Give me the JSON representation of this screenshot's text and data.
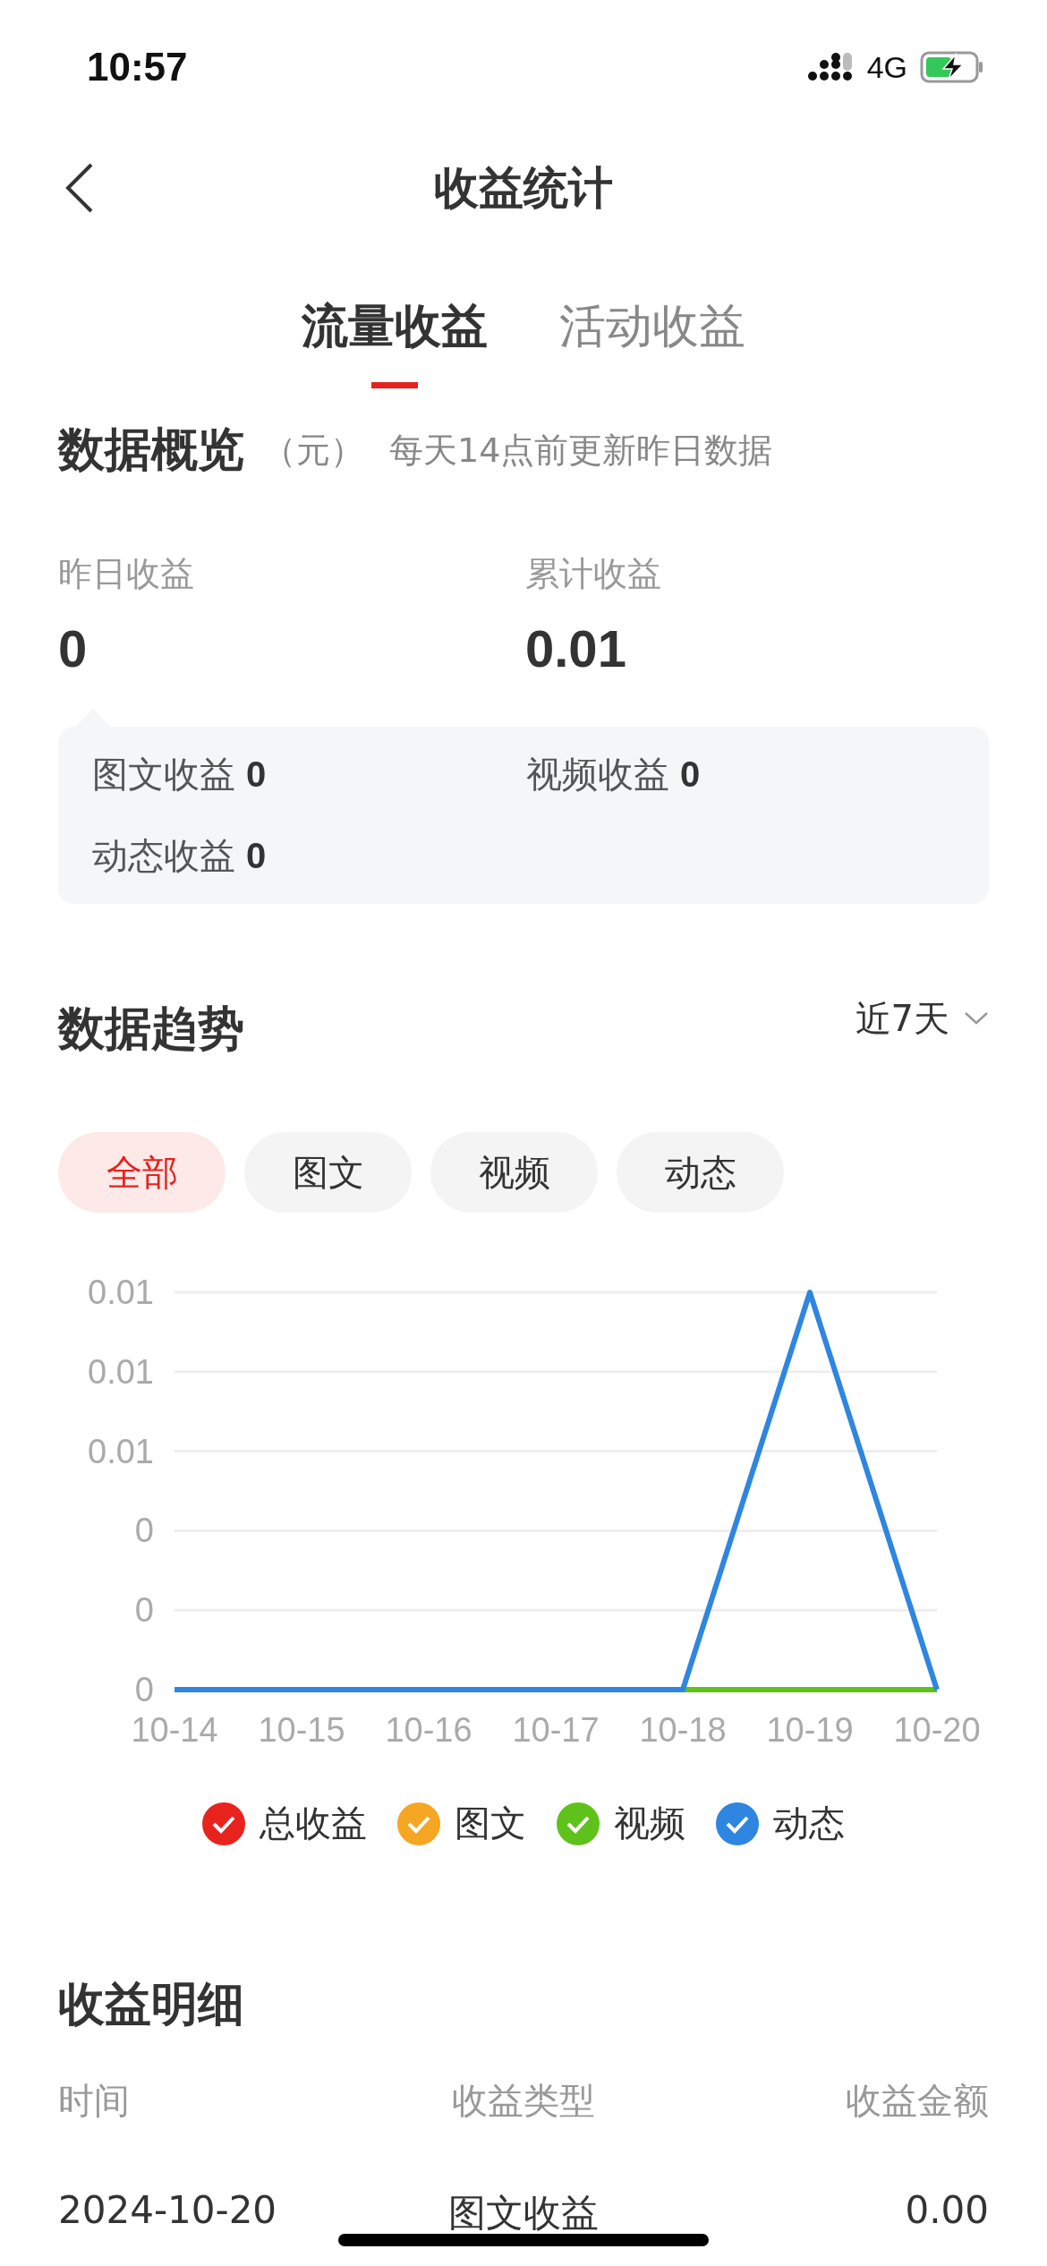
{
  "status_bar": {
    "time": "10:57",
    "network": "4G"
  },
  "header": {
    "title": "收益统计"
  },
  "tabs": [
    {
      "label": "流量收益",
      "selected": true
    },
    {
      "label": "活动收益",
      "selected": false
    }
  ],
  "overview": {
    "title": "数据概览",
    "unit": "（元）",
    "note": "每天14点前更新昨日数据",
    "stats": [
      {
        "label": "昨日收益",
        "value": "0"
      },
      {
        "label": "累计收益",
        "value": "0.01"
      }
    ],
    "breakdown": [
      {
        "label": "图文收益",
        "value": "0"
      },
      {
        "label": "视频收益",
        "value": "0"
      },
      {
        "label": "动态收益",
        "value": "0"
      }
    ]
  },
  "trend": {
    "title": "数据趋势",
    "range": "近7天",
    "filters": [
      {
        "label": "全部",
        "selected": true
      },
      {
        "label": "图文",
        "selected": false
      },
      {
        "label": "视频",
        "selected": false
      },
      {
        "label": "动态",
        "selected": false
      }
    ],
    "chart_data": {
      "type": "line",
      "x": [
        "10-14",
        "10-15",
        "10-16",
        "10-17",
        "10-18",
        "10-19",
        "10-20"
      ],
      "ylim": [
        0,
        0.01
      ],
      "grid": true,
      "yticks": [
        0,
        {
          "value": 0.002,
          "label": "0"
        },
        {
          "value": 0.004,
          "label": "0"
        },
        {
          "value": 0.006,
          "label": "0.01"
        },
        {
          "value": 0.008,
          "label": "0.01"
        },
        {
          "value": 0.01,
          "label": "0.01"
        }
      ],
      "series": [
        {
          "name": "总收益",
          "color": "#e8231e",
          "values": [
            null,
            null,
            null,
            null,
            null,
            null,
            null
          ]
        },
        {
          "name": "图文",
          "color": "#f5a623",
          "values": [
            null,
            null,
            null,
            null,
            null,
            null,
            null
          ]
        },
        {
          "name": "视频",
          "color": "#5ec21b",
          "values": [
            null,
            null,
            null,
            null,
            0,
            0,
            0
          ]
        },
        {
          "name": "动态",
          "color": "#2e86e0",
          "values": [
            0,
            0,
            0,
            0,
            0,
            0.01,
            0
          ]
        }
      ]
    }
  },
  "details": {
    "title": "收益明细",
    "columns": [
      "时间",
      "收益类型",
      "收益金额"
    ],
    "rows": [
      [
        "2024-10-20",
        "图文收益",
        "0.00"
      ]
    ]
  }
}
